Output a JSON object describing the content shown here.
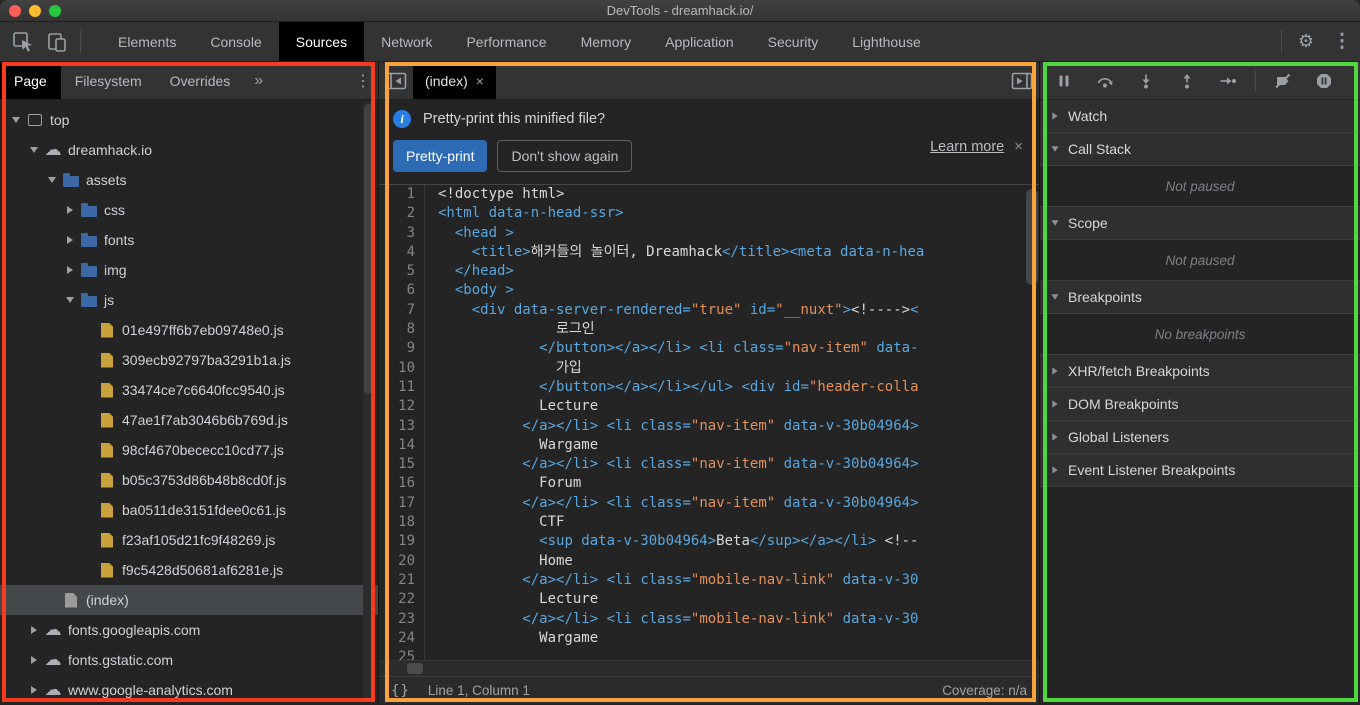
{
  "window": {
    "title": "DevTools - dreamhack.io/"
  },
  "icons": {
    "gear": "⚙",
    "more": "⋮",
    "chevron_double": "»",
    "info": "i",
    "close": "×"
  },
  "colors": {
    "tag": "#58a7e0",
    "str": "#e2905c",
    "code-tx": "#d9d9d9"
  },
  "annotations": {
    "left": "#f63b20",
    "middle": "#f8a33c",
    "right": "#4ed83d"
  },
  "main_tabs": {
    "items": [
      "Elements",
      "Console",
      "Sources",
      "Network",
      "Performance",
      "Memory",
      "Application",
      "Security",
      "Lighthouse"
    ],
    "active": "Sources"
  },
  "sidebar": {
    "tabs": [
      "Page",
      "Filesystem",
      "Overrides"
    ],
    "active_tab": "Page",
    "tree": [
      {
        "label": "top",
        "icon": "frame",
        "arrow": "down",
        "level": 0
      },
      {
        "label": "dreamhack.io",
        "icon": "cloud",
        "arrow": "down",
        "level": 1
      },
      {
        "label": "assets",
        "icon": "folder",
        "arrow": "down",
        "level": 2
      },
      {
        "label": "css",
        "icon": "folder",
        "arrow": "right",
        "level": 3
      },
      {
        "label": "fonts",
        "icon": "folder",
        "arrow": "right",
        "level": 3
      },
      {
        "label": "img",
        "icon": "folder",
        "arrow": "right",
        "level": 3
      },
      {
        "label": "js",
        "icon": "folder",
        "arrow": "down",
        "level": 3
      },
      {
        "label": "01e497ff6b7eb09748e0.js",
        "icon": "file-js",
        "arrow": "none",
        "level": 4
      },
      {
        "label": "309ecb92797ba3291b1a.js",
        "icon": "file-js",
        "arrow": "none",
        "level": 4
      },
      {
        "label": "33474ce7c6640fcc9540.js",
        "icon": "file-js",
        "arrow": "none",
        "level": 4
      },
      {
        "label": "47ae1f7ab3046b6b769d.js",
        "icon": "file-js",
        "arrow": "none",
        "level": 4
      },
      {
        "label": "98cf4670bececc10cd77.js",
        "icon": "file-js",
        "arrow": "none",
        "level": 4
      },
      {
        "label": "b05c3753d86b48b8cd0f.js",
        "icon": "file-js",
        "arrow": "none",
        "level": 4
      },
      {
        "label": "ba0511de3151fdee0c61.js",
        "icon": "file-js",
        "arrow": "none",
        "level": 4
      },
      {
        "label": "f23af105d21fc9f48269.js",
        "icon": "file-js",
        "arrow": "none",
        "level": 4
      },
      {
        "label": "f9c5428d50681af6281e.js",
        "icon": "file-js",
        "arrow": "none",
        "level": 4
      },
      {
        "label": "(index)",
        "icon": "file-plain",
        "arrow": "none",
        "level": 2,
        "selected": true
      },
      {
        "label": "fonts.googleapis.com",
        "icon": "cloud",
        "arrow": "right",
        "level": 1
      },
      {
        "label": "fonts.gstatic.com",
        "icon": "cloud",
        "arrow": "right",
        "level": 1
      },
      {
        "label": "www.google-analytics.com",
        "icon": "cloud",
        "arrow": "right",
        "level": 1
      }
    ]
  },
  "editor": {
    "tab": {
      "label": "(index)",
      "close": "×"
    },
    "banner": {
      "message": "Pretty-print this minified file?",
      "learn_more": "Learn more",
      "primary": "Pretty-print",
      "secondary": "Don't show again"
    },
    "code_lines": [
      "<!doctype html>",
      "<html data-n-head-ssr>",
      "  <head >",
      "    <title>해커들의 놀이터, Dreamhack</title><meta data-n-hea",
      "  </head>",
      "  <body >",
      "    <div data-server-rendered=\"true\" id=\"__nuxt\"><!----><",
      "              로그인",
      "            </button></a></li> <li class=\"nav-item\" data-",
      "              가입",
      "            </button></a></li></ul> <div id=\"header-colla",
      "            Lecture",
      "          </a></li> <li class=\"nav-item\" data-v-30b04964>",
      "            Wargame",
      "          </a></li> <li class=\"nav-item\" data-v-30b04964>",
      "            Forum",
      "          </a></li> <li class=\"nav-item\" data-v-30b04964>",
      "            CTF",
      "            <sup data-v-30b04964>Beta</sup></a></li> <!--",
      "            Home",
      "          </a></li> <li class=\"mobile-nav-link\" data-v-30",
      "            Lecture",
      "          </a></li> <li class=\"mobile-nav-link\" data-v-30",
      "            Wargame",
      ""
    ],
    "status": {
      "format_icon": "{}",
      "line_col": "Line 1, Column 1",
      "coverage": "Coverage: n/a"
    }
  },
  "debugger": {
    "sections": [
      {
        "label": "Watch",
        "state": "collapsed"
      },
      {
        "label": "Call Stack",
        "state": "expanded",
        "placeholder": "Not paused"
      },
      {
        "label": "Scope",
        "state": "expanded",
        "placeholder": "Not paused"
      },
      {
        "label": "Breakpoints",
        "state": "expanded",
        "placeholder": "No breakpoints"
      },
      {
        "label": "XHR/fetch Breakpoints",
        "state": "collapsed"
      },
      {
        "label": "DOM Breakpoints",
        "state": "collapsed"
      },
      {
        "label": "Global Listeners",
        "state": "collapsed"
      },
      {
        "label": "Event Listener Breakpoints",
        "state": "collapsed"
      }
    ]
  }
}
